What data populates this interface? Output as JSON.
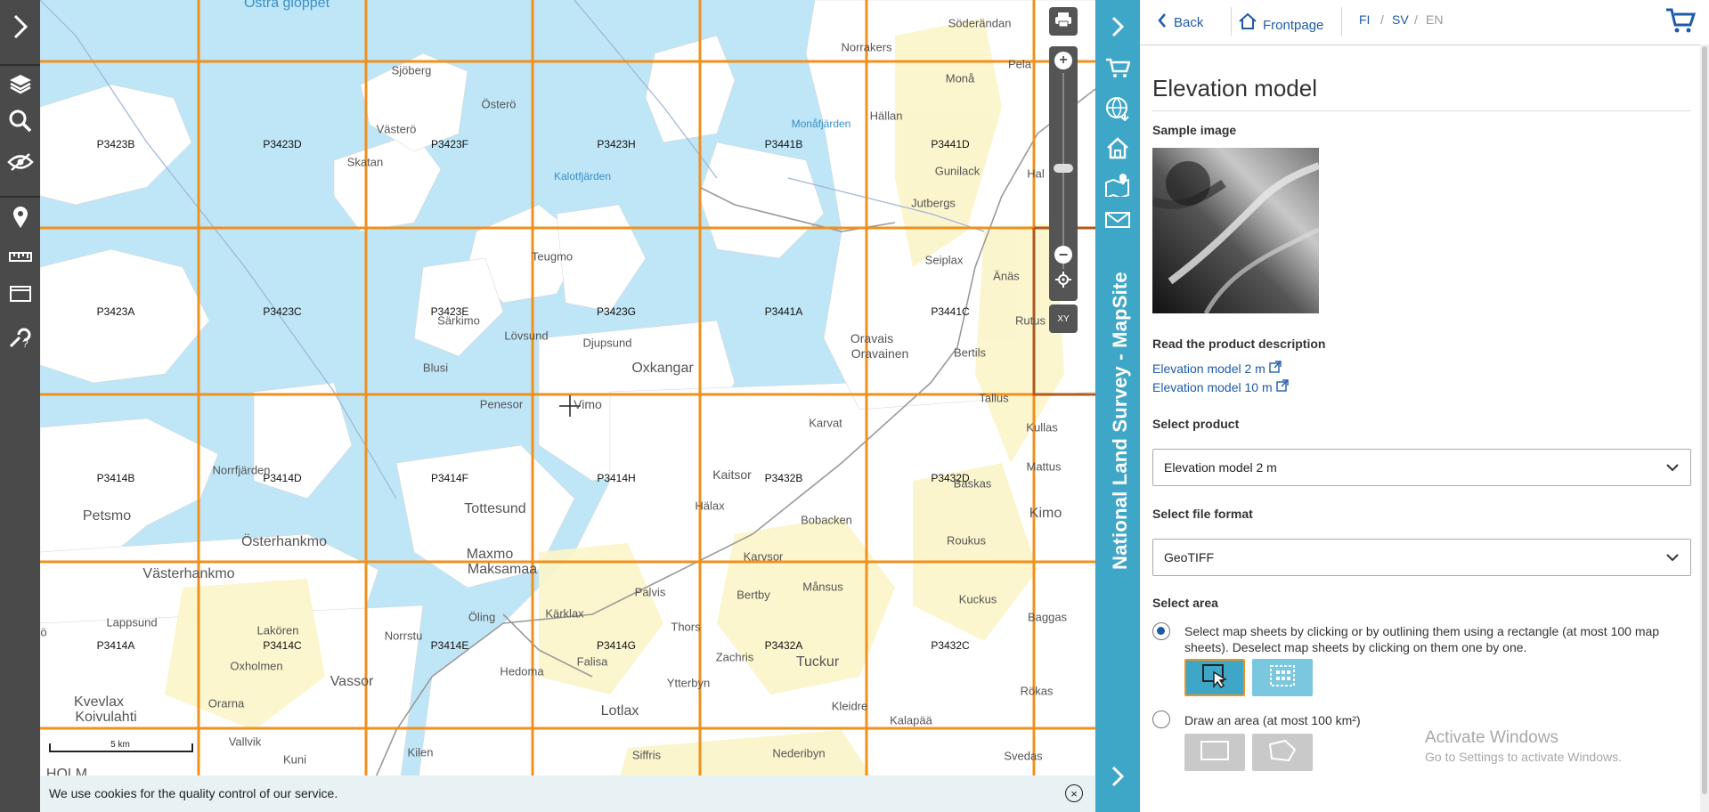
{
  "map": {
    "sheet_labels": {
      "row1": [
        "P3423B",
        "P3423D",
        "P3423F",
        "P3423H",
        "P3441B",
        "P3441D"
      ],
      "row2": [
        "P3423A",
        "P3423C",
        "P3423E",
        "P3423G",
        "P3441A",
        "P3441C"
      ],
      "row3": [
        "P3414B",
        "P3414D",
        "P3414F",
        "P3414H",
        "P3432B",
        "P3432D"
      ],
      "row4": [
        "P3414A",
        "P3414C",
        "P3414E",
        "P3414G",
        "P3432A",
        "P3432C"
      ]
    },
    "places": {
      "ostra_gloppet": "Östra glöppet",
      "soderandan": "Söderändan",
      "norrakers": "Norrakers",
      "pela": "Pela",
      "sjoberg": "Sjöberg",
      "ostero": "Österö",
      "vastero": "Västerö",
      "mona": "Monå",
      "monafjarden": "Monåfjärden",
      "hallan": "Hällan",
      "skatan": "Skatan",
      "kalotfjarden": "Kalotfjärden",
      "gunilack": "Gunilack",
      "jutbergs": "Jutbergs",
      "teugmo": "Teugmo",
      "seiplax": "Seiplax",
      "anas": "Änäs",
      "sarkimo": "Särkimo",
      "lovsund": "Lövsund",
      "djupsund": "Djupsund",
      "oxkangar": "Oxkangar",
      "oravais": "Oravais",
      "oravainen": "Oravainen",
      "bertils": "Bertils",
      "blusi": "Blusi",
      "penesor": "Penesor",
      "vimo": "Vimo",
      "tallus": "Tallus",
      "karvat": "Karvat",
      "kullas": "Kullas",
      "norrfjarden": "Norrfjärden",
      "kaitsor": "Kaitsor",
      "mattus": "Mattus",
      "baskas": "Baskas",
      "petsmo": "Petsmo",
      "tottesund": "Tottesund",
      "halax": "Hälax",
      "bobacken": "Bobacken",
      "kimo": "Kimo",
      "osterhankmo": "Österhankmo",
      "maxmo": "Maxmo",
      "maksamaa": "Maksamaa",
      "karvsor": "Karvsor",
      "roukus": "Roukus",
      "vasterhankmo": "Västerhankmo",
      "palvis": "Palvis",
      "bertby": "Bertby",
      "mansus": "Månsus",
      "kuckus": "Kuckus",
      "lappsund": "Lappsund",
      "lakoren": "Lakören",
      "norrstu": "Norrstu",
      "oling": "Öling",
      "karklax": "Kärklax",
      "thors": "Thors",
      "baggas": "Baggas",
      "tuckur": "Tuckur",
      "oxholmen": "Oxholmen",
      "falisa": "Falisa",
      "zachris": "Zachris",
      "vassor": "Vassor",
      "hedoma": "Hedoma",
      "ytterbyn": "Ytterbyn",
      "rokas": "Rökas",
      "kvevlax": "Kvevlax",
      "koivulahti": "Koivulahti",
      "orarna": "Orarna",
      "lotlax": "Lotlax",
      "kleidre": "Kleidre",
      "vallvik": "Vallvik",
      "kalapaa": "Kalapää",
      "kilen": "Kilen",
      "siffris": "Siffris",
      "nederibyn": "Nederibyn",
      "svedas": "Svedas",
      "kuni": "Kuni",
      "o_edge": "ö",
      "holm": "HOLM",
      "rutus": "Rutus",
      "hal": "Hal"
    },
    "scale_label": "5 km",
    "cookie_text": "We use cookies for the quality control of our service.",
    "xy_label": "XY"
  },
  "side": {
    "brand": "National Land Survey - MapSite"
  },
  "panel": {
    "back_label": "Back",
    "frontpage_label": "Frontpage",
    "langs": [
      "FI",
      "SV",
      "EN"
    ],
    "lang_sep": "/",
    "title": "Elevation model",
    "sample_image_label": "Sample image",
    "read_desc_label": "Read the product description",
    "links": [
      "Elevation model 2 m",
      "Elevation model 10 m"
    ],
    "select_product_label": "Select product",
    "product_value": "Elevation model 2 m",
    "select_format_label": "Select file format",
    "format_value": "GeoTIFF",
    "select_area_label": "Select area",
    "option1_text": "Select map sheets by clicking or by outlining them using a rectangle (at most 100 map sheets). Deselect map sheets by clicking on them one by one.",
    "option2_text": "Draw an area (at most 100 km²)",
    "activate_title": "Activate Windows",
    "activate_sub": "Go to Settings to activate Windows."
  },
  "colors": {
    "grid": "#f0901e",
    "water": "#bfe6f7",
    "land": "#ffffff",
    "accent": "#3ea6c7",
    "link": "#1e5aa8"
  }
}
